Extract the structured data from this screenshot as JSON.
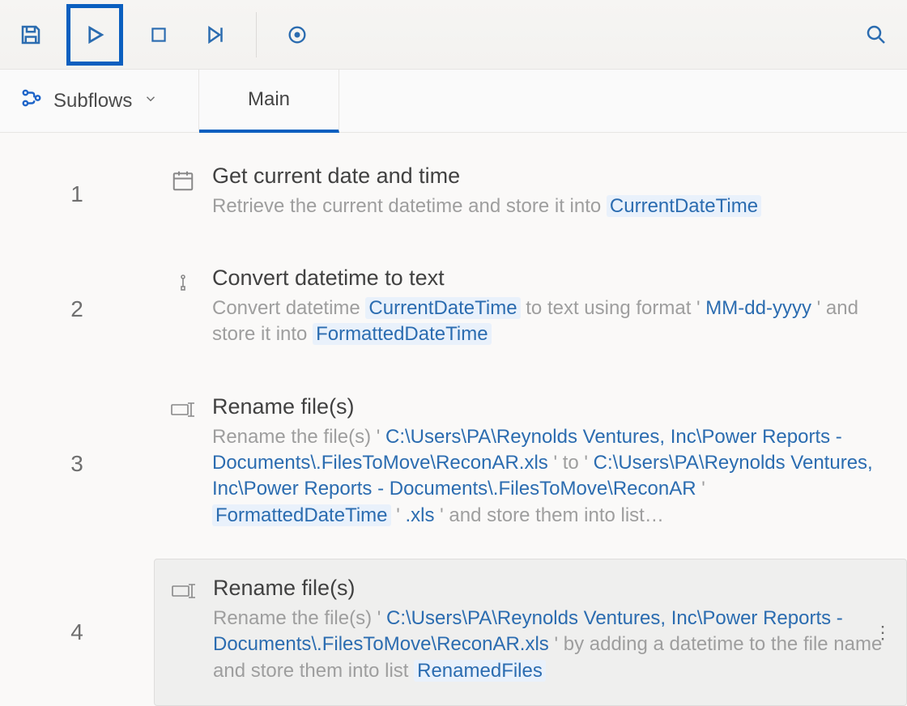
{
  "toolbar": {
    "save": "save",
    "run": "run",
    "stop": "stop",
    "step": "run-next",
    "record": "record",
    "search": "search"
  },
  "tabs": {
    "subflows_label": "Subflows",
    "main_label": "Main"
  },
  "steps": [
    {
      "num": "1",
      "title": "Get current date and time",
      "desc_prefix": "Retrieve the current datetime and store it into ",
      "var1": "CurrentDateTime"
    },
    {
      "num": "2",
      "title": "Convert datetime to text",
      "p1": "Convert datetime ",
      "var1": "CurrentDateTime",
      "p2": "  to text using format '",
      "lit1": "MM-dd-yyyy",
      "p3": "' and store it into  ",
      "var2": "FormattedDateTime"
    },
    {
      "num": "3",
      "title": "Rename file(s)",
      "p1": "Rename the file(s) '",
      "path1": "C:\\Users\\PA\\Reynolds Ventures, Inc\\Power Reports - Documents\\.FilesToMove\\ReconAR.xls",
      "p2": "' to '",
      "path2": "C:\\Users\\PA\\Reynolds Ventures, Inc\\Power Reports - Documents\\.FilesToMove\\ReconAR ",
      "p3": "' ",
      "var1": "FormattedDateTime",
      "p4": "  '",
      "lit1": ".xls",
      "p5": "' and store them into list…"
    },
    {
      "num": "4",
      "title": "Rename file(s)",
      "p1": "Rename the file(s) '",
      "path1": "C:\\Users\\PA\\Reynolds Ventures, Inc\\Power Reports - Documents\\.FilesToMove\\ReconAR.xls",
      "p2": "' by adding a datetime to the file name and store them into list  ",
      "var1": "RenamedFiles"
    }
  ]
}
